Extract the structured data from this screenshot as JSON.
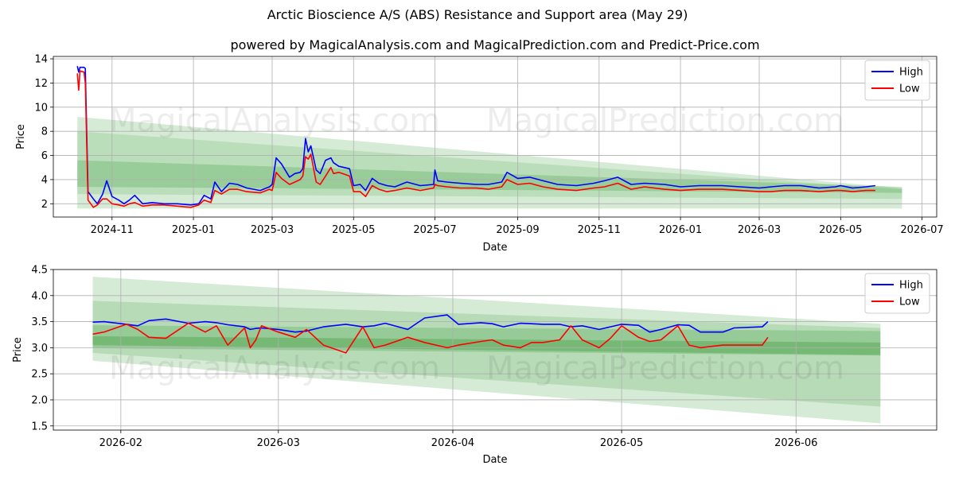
{
  "figure": {
    "title": "Arctic Bioscience A/S (ABS) Resistance and Support area (May 29)"
  },
  "chart_data": [
    {
      "type": "line",
      "title": "powered by MagicalAnalysis.com and MagicalPrediction.com and Predict-Price.com",
      "xlabel": "Date",
      "ylabel": "Price",
      "xlim": [
        "2024-09-18",
        "2026-07-12"
      ],
      "ylim": [
        0.9,
        14.2
      ],
      "yticks": [
        2,
        4,
        6,
        8,
        10,
        12,
        14
      ],
      "xticks": [
        "2024-11",
        "2025-01",
        "2025-03",
        "2025-05",
        "2025-07",
        "2025-09",
        "2025-11",
        "2026-01",
        "2026-03",
        "2026-05",
        "2026-07"
      ],
      "grid": true,
      "legend": "top-right",
      "watermarks": [
        "MagicalAnalysis.com",
        "MagicalPrediction.com"
      ],
      "bands": [
        {
          "x": [
            "2024-10-06",
            "2026-06-16"
          ],
          "upper": [
            9.2,
            3.3
          ],
          "lower": [
            1.6,
            1.6
          ],
          "opacity": 0.16
        },
        {
          "x": [
            "2024-10-06",
            "2026-06-16"
          ],
          "upper": [
            8.0,
            3.2
          ],
          "lower": [
            2.8,
            2.4
          ],
          "opacity": 0.13
        },
        {
          "x": [
            "2024-10-06",
            "2026-06-16"
          ],
          "upper": [
            5.6,
            3.4
          ],
          "lower": [
            3.4,
            2.9
          ],
          "opacity": 0.18
        }
      ],
      "series": [
        {
          "name": "High",
          "color": "#0000ff",
          "x": [
            "2024-10-06",
            "2024-10-07",
            "2024-10-08",
            "2024-10-11",
            "2024-10-12",
            "2024-10-14",
            "2024-10-18",
            "2024-10-21",
            "2024-10-25",
            "2024-10-28",
            "2024-11-01",
            "2024-11-06",
            "2024-11-10",
            "2024-11-14",
            "2024-11-18",
            "2024-11-24",
            "2024-12-01",
            "2024-12-10",
            "2024-12-20",
            "2024-12-30",
            "2025-01-05",
            "2025-01-09",
            "2025-01-14",
            "2025-01-17",
            "2025-01-22",
            "2025-01-28",
            "2025-02-03",
            "2025-02-10",
            "2025-02-20",
            "2025-02-27",
            "2025-03-01",
            "2025-03-04",
            "2025-03-08",
            "2025-03-14",
            "2025-03-18",
            "2025-03-22",
            "2025-03-24",
            "2025-03-26",
            "2025-03-28",
            "2025-03-30",
            "2025-04-03",
            "2025-04-06",
            "2025-04-10",
            "2025-04-14",
            "2025-04-16",
            "2025-04-20",
            "2025-04-28",
            "2025-05-01",
            "2025-05-06",
            "2025-05-10",
            "2025-05-15",
            "2025-05-20",
            "2025-05-26",
            "2025-06-01",
            "2025-06-10",
            "2025-06-20",
            "2025-06-30",
            "2025-07-01",
            "2025-07-03",
            "2025-07-10",
            "2025-07-20",
            "2025-08-01",
            "2025-08-10",
            "2025-08-20",
            "2025-08-24",
            "2025-09-01",
            "2025-09-10",
            "2025-09-20",
            "2025-10-01",
            "2025-10-15",
            "2025-10-28",
            "2025-11-05",
            "2025-11-15",
            "2025-11-25",
            "2025-12-05",
            "2025-12-20",
            "2026-01-01",
            "2026-01-15",
            "2026-02-01",
            "2026-02-15",
            "2026-03-01",
            "2026-03-10",
            "2026-03-20",
            "2026-04-01",
            "2026-04-15",
            "2026-04-27",
            "2026-05-01",
            "2026-05-10",
            "2026-05-20",
            "2026-05-27"
          ],
          "values": [
            13.4,
            12.9,
            13.3,
            13.3,
            13.2,
            3.0,
            2.4,
            2.0,
            2.8,
            3.9,
            2.6,
            2.3,
            2.0,
            2.3,
            2.7,
            2.0,
            2.1,
            2.0,
            2.0,
            1.9,
            2.0,
            2.7,
            2.4,
            3.8,
            3.0,
            3.7,
            3.6,
            3.3,
            3.1,
            3.4,
            3.6,
            5.8,
            5.3,
            4.2,
            4.5,
            4.6,
            4.9,
            7.4,
            6.3,
            6.8,
            4.8,
            4.5,
            5.6,
            5.8,
            5.4,
            5.1,
            4.9,
            3.5,
            3.6,
            3.1,
            4.1,
            3.7,
            3.5,
            3.4,
            3.8,
            3.5,
            3.6,
            4.8,
            3.9,
            3.8,
            3.7,
            3.6,
            3.6,
            3.8,
            4.6,
            4.1,
            4.2,
            3.9,
            3.6,
            3.5,
            3.7,
            3.9,
            4.2,
            3.6,
            3.7,
            3.6,
            3.4,
            3.5,
            3.5,
            3.4,
            3.3,
            3.4,
            3.5,
            3.5,
            3.3,
            3.4,
            3.5,
            3.3,
            3.4,
            3.5
          ]
        },
        {
          "name": "Low",
          "color": "#ff0000",
          "x": [
            "2024-10-06",
            "2024-10-07",
            "2024-10-08",
            "2024-10-11",
            "2024-10-12",
            "2024-10-14",
            "2024-10-18",
            "2024-10-21",
            "2024-10-25",
            "2024-10-28",
            "2024-11-01",
            "2024-11-06",
            "2024-11-10",
            "2024-11-14",
            "2024-11-18",
            "2024-11-24",
            "2024-12-01",
            "2024-12-10",
            "2024-12-20",
            "2024-12-30",
            "2025-01-05",
            "2025-01-09",
            "2025-01-14",
            "2025-01-17",
            "2025-01-22",
            "2025-01-28",
            "2025-02-03",
            "2025-02-10",
            "2025-02-20",
            "2025-02-27",
            "2025-03-01",
            "2025-03-04",
            "2025-03-08",
            "2025-03-14",
            "2025-03-18",
            "2025-03-22",
            "2025-03-24",
            "2025-03-26",
            "2025-03-28",
            "2025-03-30",
            "2025-04-03",
            "2025-04-06",
            "2025-04-10",
            "2025-04-14",
            "2025-04-16",
            "2025-04-20",
            "2025-04-28",
            "2025-05-01",
            "2025-05-06",
            "2025-05-10",
            "2025-05-15",
            "2025-05-20",
            "2025-05-26",
            "2025-06-01",
            "2025-06-10",
            "2025-06-20",
            "2025-06-30",
            "2025-07-01",
            "2025-07-03",
            "2025-07-10",
            "2025-07-20",
            "2025-08-01",
            "2025-08-10",
            "2025-08-20",
            "2025-08-24",
            "2025-09-01",
            "2025-09-10",
            "2025-09-20",
            "2025-10-01",
            "2025-10-15",
            "2025-10-28",
            "2025-11-05",
            "2025-11-15",
            "2025-11-25",
            "2025-12-05",
            "2025-12-20",
            "2026-01-01",
            "2026-01-15",
            "2026-02-01",
            "2026-02-15",
            "2026-03-01",
            "2026-03-10",
            "2026-03-20",
            "2026-04-01",
            "2026-04-15",
            "2026-04-27",
            "2026-05-01",
            "2026-05-10",
            "2026-05-20",
            "2026-05-27"
          ],
          "values": [
            12.8,
            11.4,
            13.0,
            12.9,
            12.0,
            2.3,
            1.7,
            1.9,
            2.4,
            2.4,
            2.0,
            1.9,
            1.8,
            2.0,
            2.1,
            1.8,
            1.9,
            1.9,
            1.8,
            1.7,
            1.9,
            2.3,
            2.1,
            3.1,
            2.8,
            3.2,
            3.2,
            3.0,
            2.9,
            3.2,
            3.1,
            4.6,
            4.1,
            3.6,
            3.8,
            4.0,
            4.3,
            5.9,
            5.7,
            6.1,
            3.8,
            3.6,
            4.3,
            5.0,
            4.5,
            4.6,
            4.3,
            3.0,
            3.0,
            2.6,
            3.5,
            3.2,
            3.0,
            3.1,
            3.3,
            3.1,
            3.3,
            3.6,
            3.5,
            3.4,
            3.3,
            3.3,
            3.2,
            3.4,
            4.0,
            3.6,
            3.7,
            3.4,
            3.2,
            3.1,
            3.3,
            3.4,
            3.7,
            3.2,
            3.4,
            3.2,
            3.1,
            3.2,
            3.2,
            3.1,
            3.0,
            3.0,
            3.1,
            3.1,
            3.0,
            3.1,
            3.1,
            3.0,
            3.1,
            3.1
          ]
        }
      ]
    },
    {
      "type": "line",
      "title": "",
      "xlabel": "Date",
      "ylabel": "Price",
      "xlim": [
        "2026-01-20",
        "2026-06-26"
      ],
      "ylim": [
        1.42,
        4.5
      ],
      "yticks": [
        1.5,
        2.0,
        2.5,
        3.0,
        3.5,
        4.0,
        4.5
      ],
      "xticks": [
        "2026-02",
        "2026-03",
        "2026-04",
        "2026-05",
        "2026-06"
      ],
      "grid": true,
      "legend": "top-right",
      "watermarks": [
        "MagicalAnalysis.com",
        "MagicalPrediction.com"
      ],
      "bands": [
        {
          "x": [
            "2026-01-27",
            "2026-06-16"
          ],
          "upper": [
            4.36,
            3.46
          ],
          "lower": [
            2.75,
            1.55
          ],
          "opacity": 0.16
        },
        {
          "x": [
            "2026-01-27",
            "2026-06-16"
          ],
          "upper": [
            3.9,
            3.38
          ],
          "lower": [
            2.9,
            1.87
          ],
          "opacity": 0.14
        },
        {
          "x": [
            "2026-01-27",
            "2026-06-16"
          ],
          "upper": [
            3.43,
            3.32
          ],
          "lower": [
            2.99,
            2.85
          ],
          "opacity": 0.18
        },
        {
          "x": [
            "2026-01-27",
            "2026-06-16"
          ],
          "upper": [
            3.22,
            3.1
          ],
          "lower": [
            3.05,
            2.86
          ],
          "opacity": 0.22
        }
      ],
      "series": [
        {
          "name": "High",
          "color": "#0000ff",
          "x": [
            "2026-01-27",
            "2026-01-29",
            "2026-02-02",
            "2026-02-04",
            "2026-02-06",
            "2026-02-09",
            "2026-02-13",
            "2026-02-16",
            "2026-02-18",
            "2026-02-20",
            "2026-02-23",
            "2026-02-24",
            "2026-02-25",
            "2026-02-26",
            "2026-03-01",
            "2026-03-04",
            "2026-03-06",
            "2026-03-09",
            "2026-03-13",
            "2026-03-16",
            "2026-03-18",
            "2026-03-20",
            "2026-03-24",
            "2026-03-27",
            "2026-03-31",
            "2026-04-02",
            "2026-04-06",
            "2026-04-08",
            "2026-04-10",
            "2026-04-13",
            "2026-04-15",
            "2026-04-17",
            "2026-04-20",
            "2026-04-22",
            "2026-04-24",
            "2026-04-27",
            "2026-04-29",
            "2026-05-01",
            "2026-05-04",
            "2026-05-06",
            "2026-05-08",
            "2026-05-11",
            "2026-05-13",
            "2026-05-15",
            "2026-05-19",
            "2026-05-21",
            "2026-05-26",
            "2026-05-27"
          ],
          "values": [
            3.49,
            3.5,
            3.45,
            3.42,
            3.52,
            3.55,
            3.47,
            3.5,
            3.48,
            3.44,
            3.4,
            3.35,
            3.37,
            3.38,
            3.35,
            3.3,
            3.32,
            3.4,
            3.45,
            3.4,
            3.42,
            3.47,
            3.35,
            3.57,
            3.63,
            3.45,
            3.48,
            3.46,
            3.4,
            3.47,
            3.46,
            3.45,
            3.45,
            3.4,
            3.42,
            3.35,
            3.4,
            3.45,
            3.43,
            3.3,
            3.35,
            3.44,
            3.43,
            3.3,
            3.3,
            3.38,
            3.4,
            3.5
          ]
        },
        {
          "name": "Low",
          "color": "#ff0000",
          "x": [
            "2026-01-27",
            "2026-01-29",
            "2026-02-02",
            "2026-02-04",
            "2026-02-06",
            "2026-02-09",
            "2026-02-13",
            "2026-02-16",
            "2026-02-18",
            "2026-02-20",
            "2026-02-23",
            "2026-02-24",
            "2026-02-25",
            "2026-02-26",
            "2026-03-01",
            "2026-03-04",
            "2026-03-06",
            "2026-03-09",
            "2026-03-13",
            "2026-03-16",
            "2026-03-18",
            "2026-03-20",
            "2026-03-24",
            "2026-03-27",
            "2026-03-31",
            "2026-04-02",
            "2026-04-06",
            "2026-04-08",
            "2026-04-10",
            "2026-04-13",
            "2026-04-15",
            "2026-04-17",
            "2026-04-20",
            "2026-04-22",
            "2026-04-24",
            "2026-04-27",
            "2026-04-29",
            "2026-05-01",
            "2026-05-04",
            "2026-05-06",
            "2026-05-08",
            "2026-05-11",
            "2026-05-13",
            "2026-05-15",
            "2026-05-19",
            "2026-05-21",
            "2026-05-26",
            "2026-05-27"
          ],
          "values": [
            3.26,
            3.3,
            3.45,
            3.35,
            3.2,
            3.18,
            3.47,
            3.3,
            3.42,
            3.05,
            3.38,
            3.0,
            3.15,
            3.42,
            3.3,
            3.2,
            3.35,
            3.05,
            2.9,
            3.4,
            3.0,
            3.05,
            3.2,
            3.1,
            3.0,
            3.05,
            3.12,
            3.15,
            3.05,
            3.0,
            3.1,
            3.1,
            3.15,
            3.42,
            3.15,
            3.0,
            3.18,
            3.42,
            3.2,
            3.12,
            3.15,
            3.42,
            3.05,
            3.0,
            3.05,
            3.05,
            3.05,
            3.2
          ]
        }
      ]
    }
  ]
}
